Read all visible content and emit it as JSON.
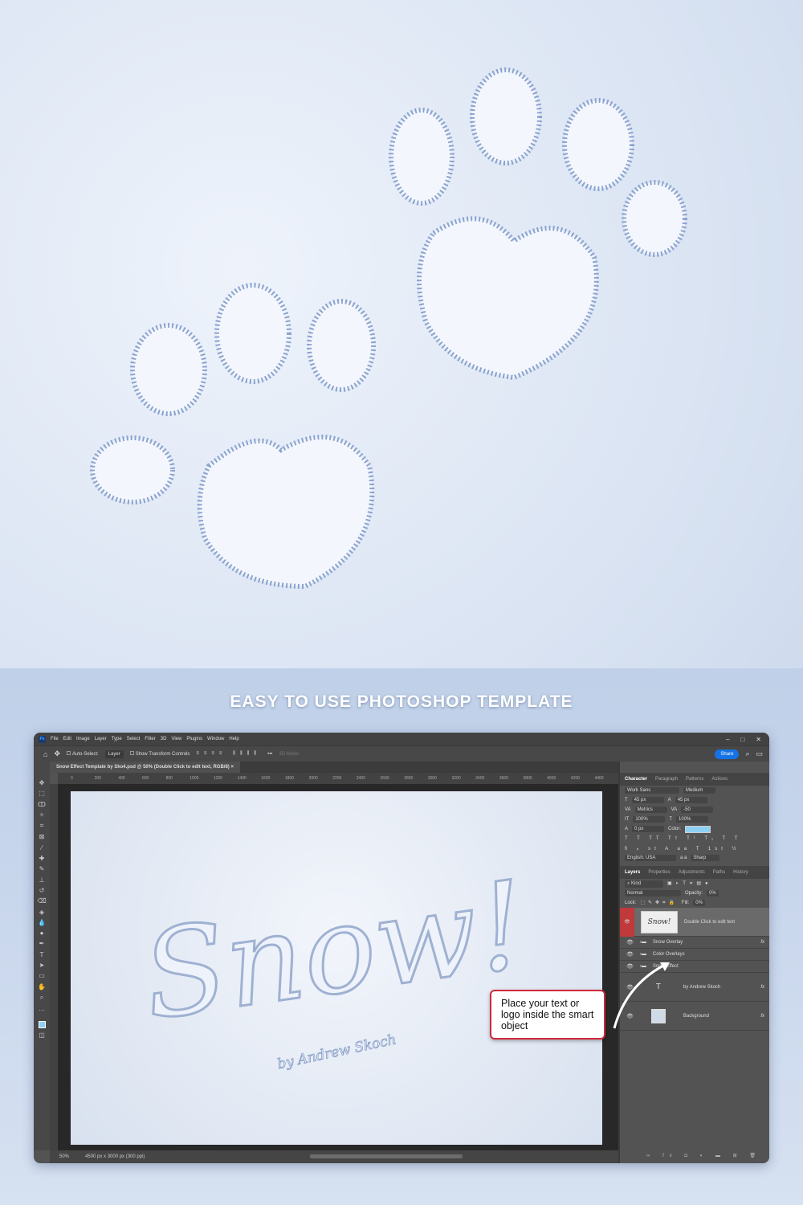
{
  "headline": "EASY TO USE PHOTOSHOP TEMPLATE",
  "menu": [
    "File",
    "Edit",
    "Image",
    "Layer",
    "Type",
    "Select",
    "Filter",
    "3D",
    "View",
    "Plugins",
    "Window",
    "Help"
  ],
  "window_controls": [
    "–",
    "□",
    "✕"
  ],
  "options": {
    "auto_select": "Auto-Select:",
    "layer_dd": "Layer",
    "transform": "Show Transform Controls",
    "mode3d": "3D Mode:",
    "share": "Share"
  },
  "doc_tab": "Snow Effect Template by Sko4.psd @ 50% (Double Click to edit text, RGB/8)",
  "ruler": [
    "0",
    "200",
    "400",
    "600",
    "800",
    "1000",
    "1200",
    "1400",
    "1600",
    "1800",
    "2000",
    "2200",
    "2400",
    "2600",
    "2800",
    "3000",
    "3200",
    "3400",
    "3600",
    "3800",
    "4000",
    "4200",
    "4400"
  ],
  "canvas": {
    "word": "Snow!",
    "signature": "by Andrew Skoch"
  },
  "status": {
    "zoom": "50%",
    "size": "4500 px x 3000 px (300 ppi)"
  },
  "character": {
    "tabs": [
      "Character",
      "Paragraph",
      "Patterns",
      "Actions"
    ],
    "font": "Work Sans",
    "style": "Medium",
    "size": "45 px",
    "leading": "45 px",
    "kerning": "Metrics",
    "tracking": "-50",
    "vscale": "100%",
    "hscale": "100%",
    "baseline": "0 px",
    "color_label": "Color:",
    "color": "#8fd0f5",
    "language": "English: USA",
    "aa_label": "a a",
    "aa": "Sharp"
  },
  "layers": {
    "tabs": [
      "Layers",
      "Properties",
      "Adjustments",
      "Paths",
      "History"
    ],
    "kind": "Kind",
    "blend": "Normal",
    "opacity_label": "Opacity:",
    "opacity": "0%",
    "lock_label": "Lock:",
    "fill_label": "Fill:",
    "fill": "0%",
    "items": [
      {
        "name": "Double Click to edit text",
        "thumb": "Snow!"
      },
      {
        "name": "Snow Overlay"
      },
      {
        "name": "Color Overlays"
      },
      {
        "name": "Snow Effect"
      },
      {
        "name": "by Andrew Skoch"
      },
      {
        "name": "Background"
      }
    ]
  },
  "callout": "Place your text or logo inside the smart object",
  "accent": "#1473e6"
}
